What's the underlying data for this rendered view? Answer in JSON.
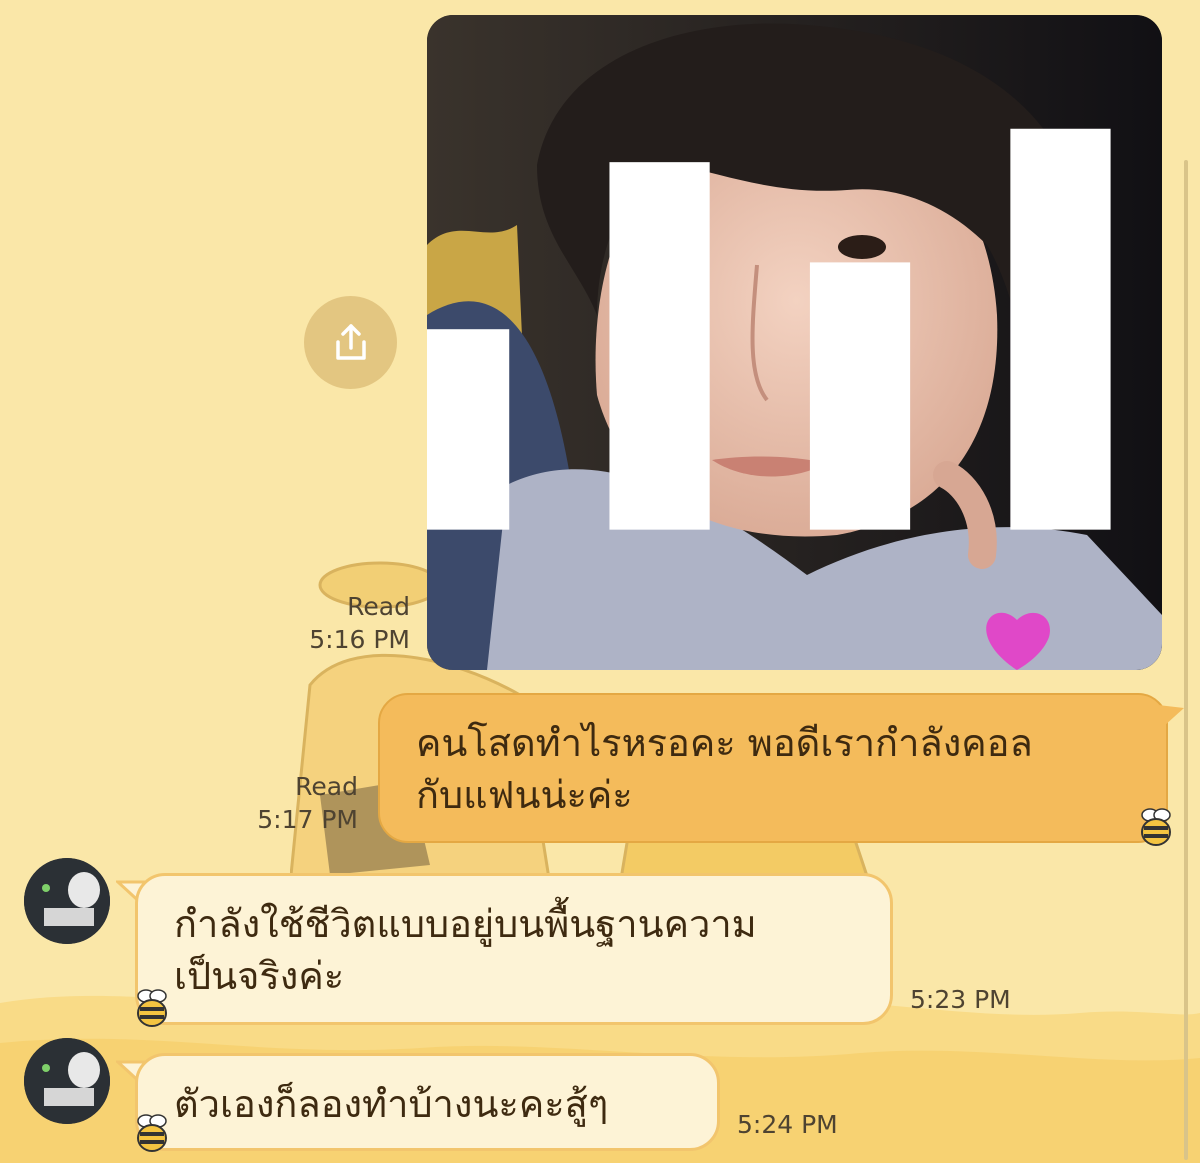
{
  "colors": {
    "background": "#fae7a8",
    "sent_bubble": "#f4bb5b",
    "received_bubble": "#fdf3d6",
    "share_button": "#e3c681"
  },
  "messages": [
    {
      "type": "image",
      "direction": "sent",
      "read_label": "Read",
      "time": "5:16 PM",
      "share_icon": "share-icon",
      "overlay_icon": "signal-bars-icon"
    },
    {
      "type": "text",
      "direction": "sent",
      "read_label": "Read",
      "time": "5:17 PM",
      "line1": "คนโสดทำไรหรอคะ พอดีเรากำลังคอล",
      "line2": "กับแฟนน่ะค่ะ"
    },
    {
      "type": "text",
      "direction": "received",
      "time": "5:23 PM",
      "line1": "กำลังใช้ชีวิตแบบอยู่บนพื้นฐานความ",
      "line2": "เป็นจริงค่ะ"
    },
    {
      "type": "text",
      "direction": "received",
      "time": "5:24 PM",
      "line1": "ตัวเองก็ลองทำบ้างนะคะสู้ๆ"
    }
  ]
}
